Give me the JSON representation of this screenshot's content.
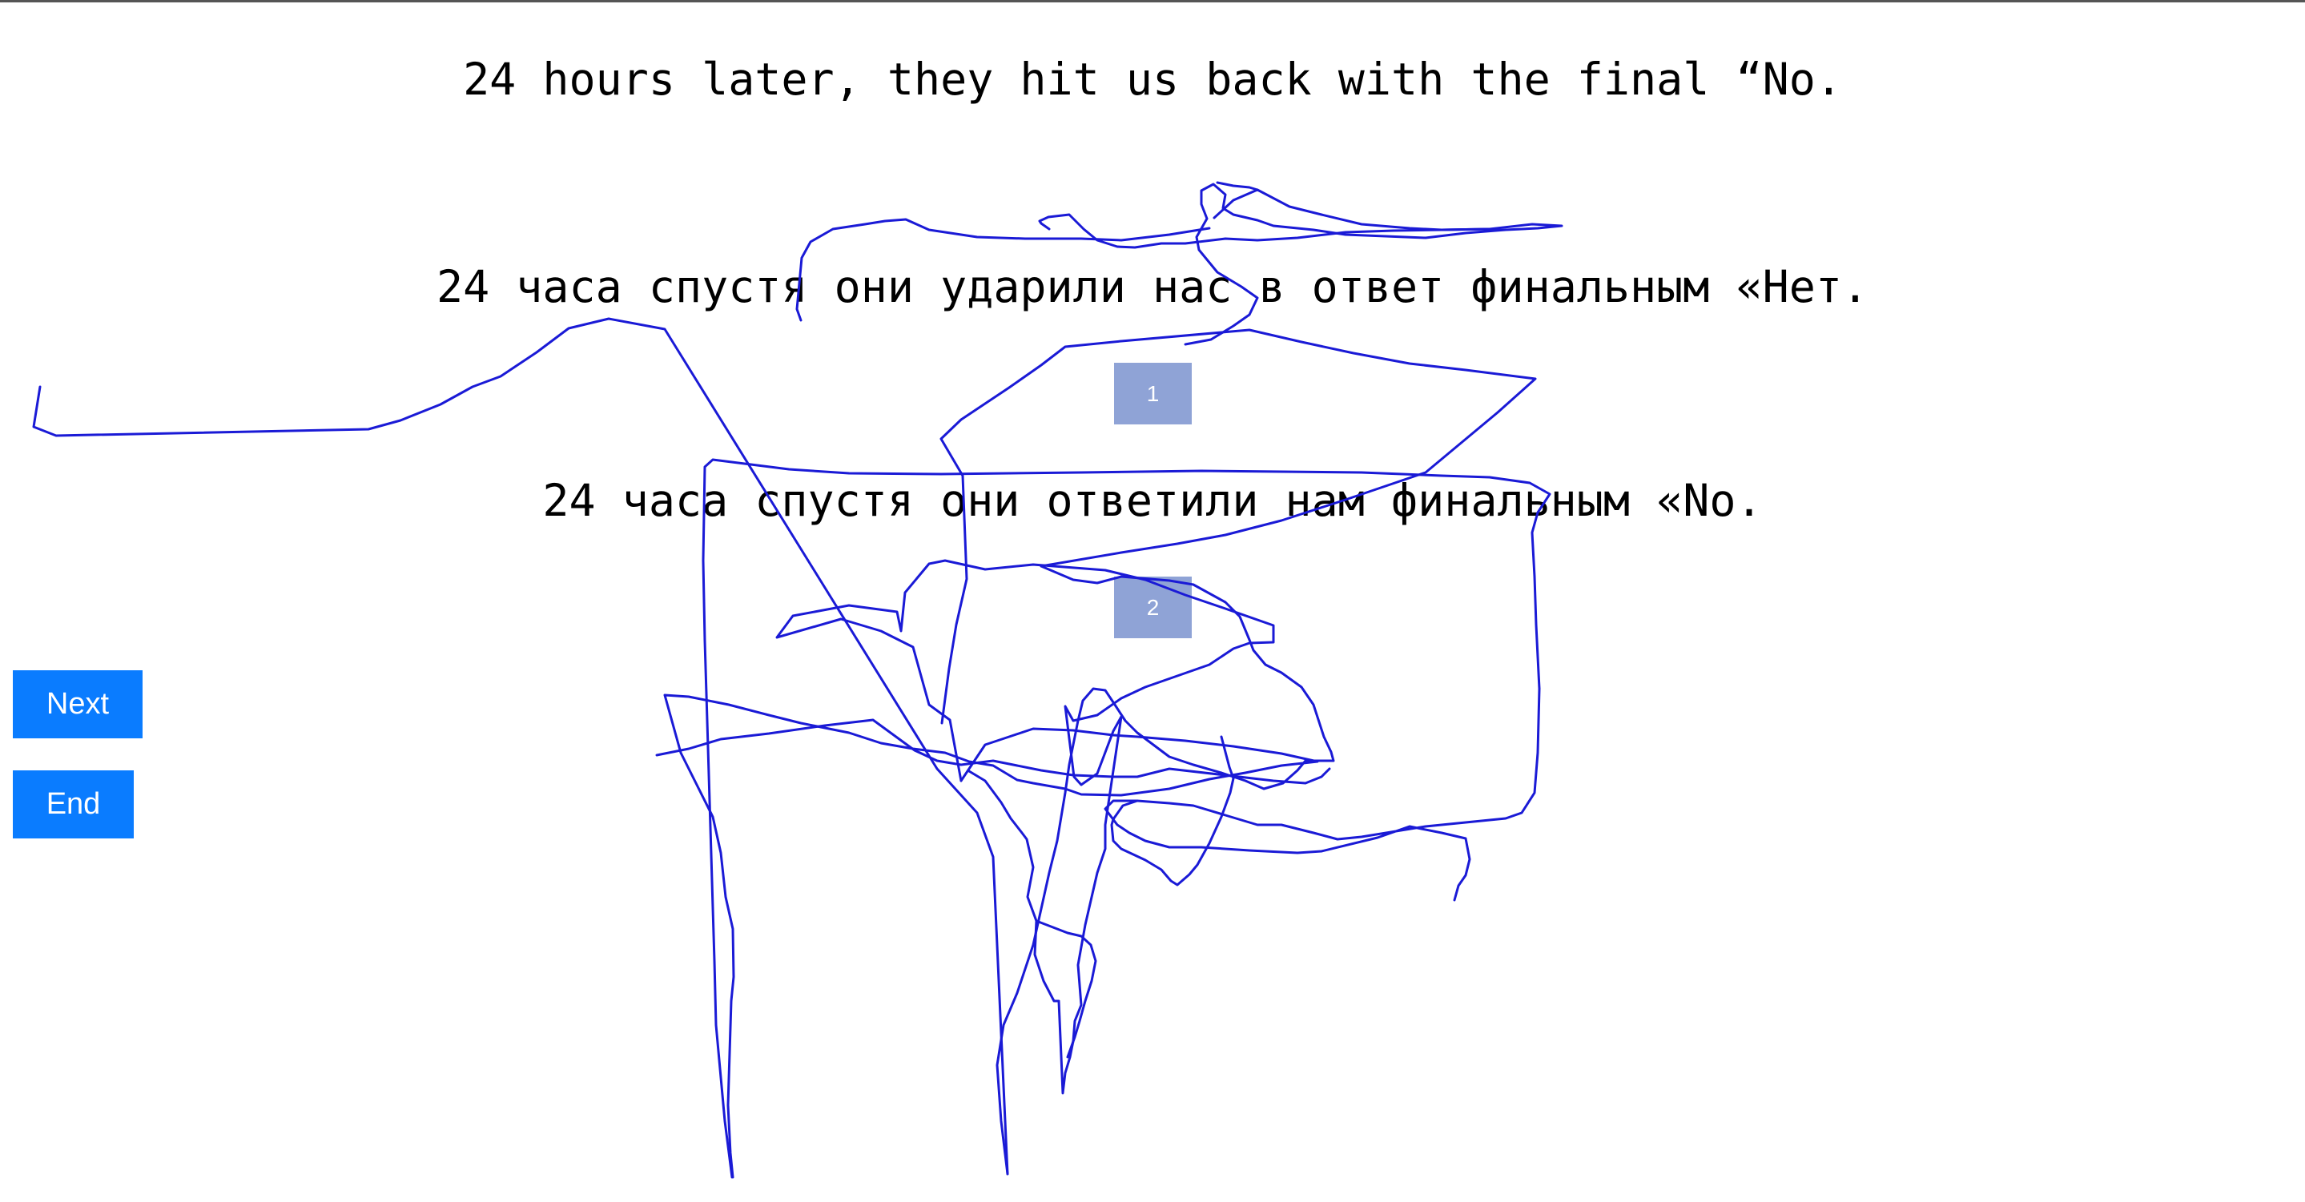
{
  "sentences": {
    "source": "24 hours later, they hit us back with the final “No.",
    "translation_1": "24 часа спустя они ударили нас в ответ финальным «Нет.",
    "translation_2": "24 часа спустя они ответили нам финальным «No."
  },
  "choices": {
    "choice_1": "1",
    "choice_2": "2"
  },
  "buttons": {
    "next": "Next",
    "end": "End"
  },
  "colors": {
    "scribble": "#1a1ad6",
    "choice_box": "#8fa3d6",
    "button": "#0a7cff"
  }
}
